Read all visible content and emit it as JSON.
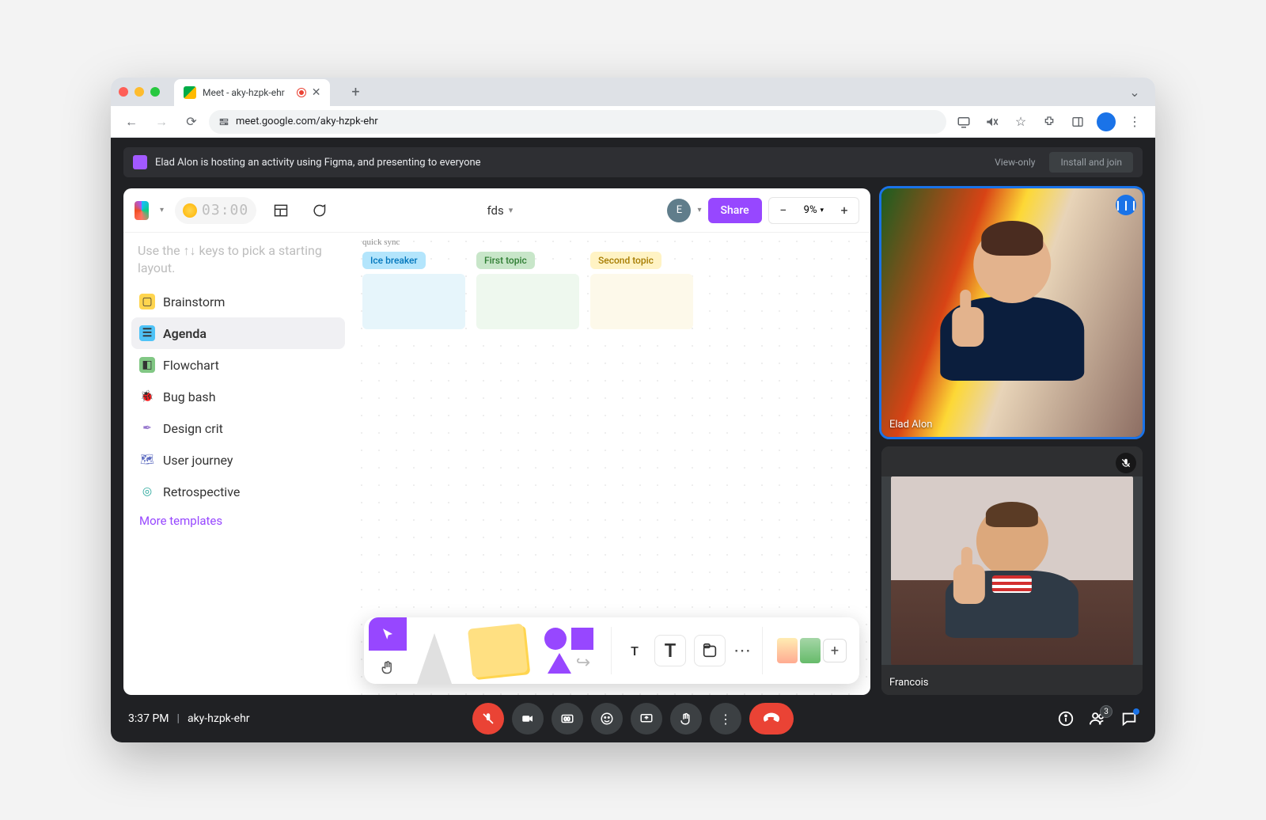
{
  "browser": {
    "tab_title": "Meet - aky-hzpk-ehr",
    "url": "meet.google.com/aky-hzpk-ehr"
  },
  "banner": {
    "text": "Elad Alon is hosting an activity using Figma, and presenting to everyone",
    "viewonly": "View-only",
    "install": "Install and join"
  },
  "figma": {
    "timer": "03:00",
    "doc_name": "fds",
    "avatar_initial": "E",
    "share": "Share",
    "zoom": "9%",
    "hint": "Use the ↑↓ keys to pick a starting layout.",
    "templates": [
      {
        "label": "Brainstorm"
      },
      {
        "label": "Agenda"
      },
      {
        "label": "Flowchart"
      },
      {
        "label": "Bug bash"
      },
      {
        "label": "Design crit"
      },
      {
        "label": "User journey"
      },
      {
        "label": "Retrospective"
      }
    ],
    "more": "More templates",
    "canvas": {
      "script": "quick sync",
      "cols": [
        {
          "tag": "Ice breaker"
        },
        {
          "tag": "First topic"
        },
        {
          "tag": "Second topic"
        }
      ]
    },
    "help": "?"
  },
  "participants": [
    {
      "name": "Elad Alon"
    },
    {
      "name": "Francois"
    }
  ],
  "footer": {
    "time": "3:37 PM",
    "code": "aky-hzpk-ehr",
    "people_count": "3"
  }
}
